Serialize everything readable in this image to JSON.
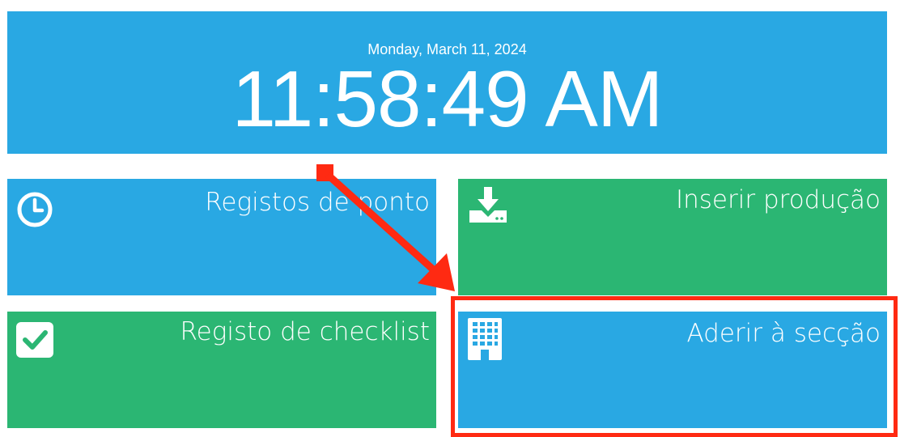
{
  "clock": {
    "date": "Monday, March 11, 2024",
    "time": "11:58:49 AM"
  },
  "tiles": [
    {
      "label": "Registos de ponto",
      "icon": "clock-icon",
      "color": "#29a8e3"
    },
    {
      "label": "Inserir produção",
      "icon": "download-tray-icon",
      "color": "#2bb673"
    },
    {
      "label": "Registo de checklist",
      "icon": "checkbox-icon",
      "color": "#2bb673"
    },
    {
      "label": "Aderir à secção",
      "icon": "building-icon",
      "color": "#29a8e3"
    }
  ],
  "annotation": {
    "highlight_color": "#ff2a12",
    "target": "Aderir à secção"
  }
}
